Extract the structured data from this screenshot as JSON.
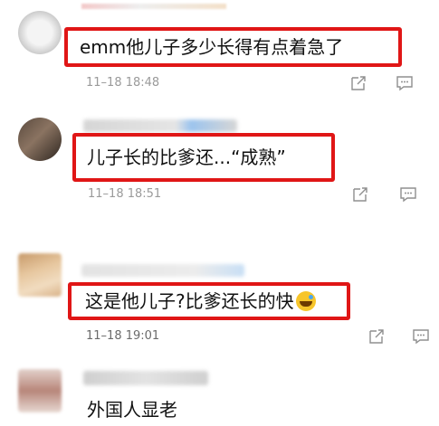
{
  "comments": [
    {
      "text": "emm他儿子多少长得有点着急了",
      "time": "11–18 18:48"
    },
    {
      "text": "儿子长的比爹还...“成熟”",
      "time": "11–18 18:51"
    },
    {
      "text": "这是他儿子?比爹还长的快",
      "time": "11–18 19:01"
    },
    {
      "text": "外国人显老"
    }
  ],
  "icons": {
    "share": "share-icon",
    "reply": "comment-icon"
  },
  "colors": {
    "highlight": "#e01616",
    "time": "#9a9a9a"
  }
}
